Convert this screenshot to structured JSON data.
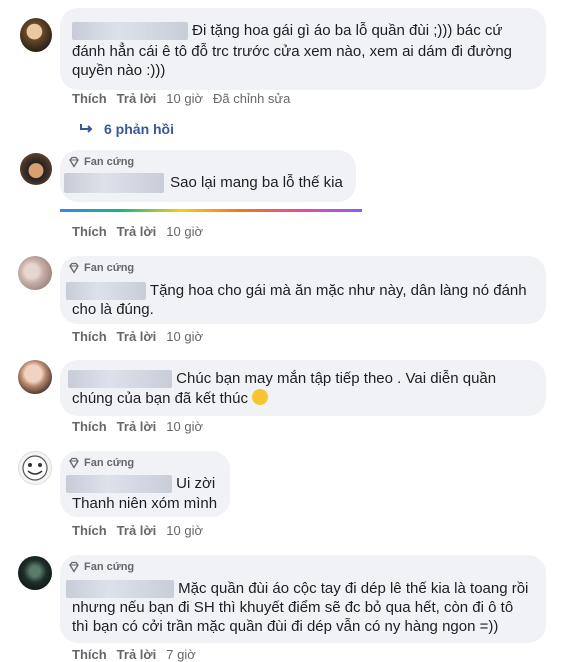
{
  "comments": [
    {
      "text": "Đi tặng hoa gái gì áo ba lỗ quần đùi ;))) bác cứ đánh hẳn cái ê tô đỗ trc trước cửa xem nào, xem ai dám đi đường quyền nào :)))",
      "line1": "Đi tặng hoa gái gì áo ba lỗ quần đùi ;))) bác cứ",
      "line2": "đánh hẳn cái ê tô đỗ trc trước cửa xem nào, xem ai dám đi đường",
      "line3": "quyền nào :)))",
      "like": "Thích",
      "reply": "Trả lời",
      "time": "10 giờ",
      "edited": "Đã chỉnh sửa",
      "replies": "6 phản hồi"
    },
    {
      "badge": "Fan cứng",
      "text": "Sao lại mang ba lỗ thế kia",
      "like": "Thích",
      "reply": "Trả lời",
      "time": "10 giờ"
    },
    {
      "badge": "Fan cứng",
      "line1": "Tặng hoa cho gái mà ăn mặc như này, dân làng nó đánh",
      "line2": "cho là đúng.",
      "like": "Thích",
      "reply": "Trả lời",
      "time": "10 giờ"
    },
    {
      "line1": "Chúc bạn may mắn tập tiếp theo . Vai diễn quần",
      "line2": "chúng của bạn đã kết thúc",
      "emoji": "🙂",
      "like": "Thích",
      "reply": "Trả lời",
      "time": "10 giờ"
    },
    {
      "badge": "Fan cứng",
      "line1": "Ui zời",
      "line2": "Thanh niên xóm mình",
      "like": "Thích",
      "reply": "Trả lời",
      "time": "10 giờ"
    },
    {
      "badge": "Fan cứng",
      "line1": "Mặc quần đùi áo cộc tay đi dép lê thế kia là toang rồi",
      "line2": "nhưng nếu bạn đi SH thì khuyết điểm sẽ đc bỏ qua hết, còn đi ô tô",
      "line3": "thì bạn có cởi trần mặc quần đùi đi dép vẫn có ny hàng ngon =))",
      "like": "Thích",
      "reply": "Trả lời",
      "time": "7 giờ"
    }
  ],
  "colors": {
    "bubble": "#f0f2f5",
    "meta": "#65676b",
    "link": "#385898"
  }
}
